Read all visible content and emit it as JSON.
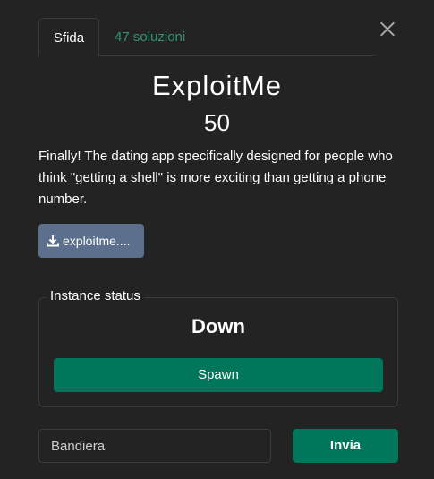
{
  "tabs": [
    {
      "label": "Sfida",
      "active": true
    },
    {
      "label": "47 soluzioni",
      "active": false
    }
  ],
  "challenge": {
    "title": "ExploitMe",
    "points": "50",
    "description": "Finally! The dating app specifically designed for people who think \"getting a shell\" is more exciting than getting a phone number."
  },
  "file": {
    "label": "exploitme....",
    "icon": "download-icon"
  },
  "instance": {
    "label": "Instance status",
    "status": "Down",
    "spawn_label": "Spawn"
  },
  "flag": {
    "placeholder": "Bandiera",
    "submit_label": "Invia"
  },
  "colors": {
    "background": "#232323",
    "accent": "#00765a",
    "tab_link": "#2f9474",
    "file_button": "#5c6f8c"
  }
}
